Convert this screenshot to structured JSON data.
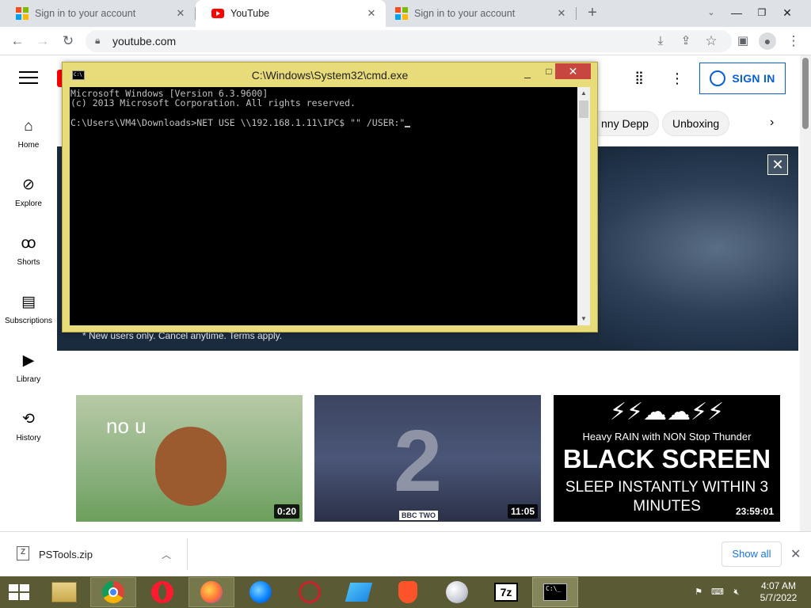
{
  "browser": {
    "tabs": [
      {
        "title": "Sign in to your account",
        "icon": "google-icon",
        "active": false
      },
      {
        "title": "YouTube",
        "icon": "youtube-icon",
        "active": true
      },
      {
        "title": "Sign in to your account",
        "icon": "google-icon",
        "active": false
      }
    ],
    "tab_close": "✕",
    "new_tab": "+",
    "url": "youtube.com"
  },
  "youtube": {
    "nav": [
      {
        "label": "Home",
        "icon": "home-icon"
      },
      {
        "label": "Explore",
        "icon": "compass-icon"
      },
      {
        "label": "Shorts",
        "icon": "shorts-icon"
      },
      {
        "label": "Subscriptions",
        "icon": "subscriptions-icon"
      },
      {
        "label": "Library",
        "icon": "library-icon"
      },
      {
        "label": "History",
        "icon": "history-icon"
      }
    ],
    "sign_in": "SIGN IN",
    "chips": [
      "nny Depp",
      "Unboxing"
    ],
    "banner_note": "* New users only. Cancel anytime. Terms apply.",
    "videos": [
      {
        "overlay": "no u",
        "duration": "0:20"
      },
      {
        "overlay": "BBC TWO",
        "duration": "11:05"
      },
      {
        "overlay_line1": "Heavy RAIN with NON Stop Thunder",
        "overlay_line2": "BLACK SCREEN",
        "overlay_line3": "SLEEP INSTANTLY WITHIN 3",
        "overlay_line4": "MINUTES",
        "duration": "23:59:01"
      }
    ]
  },
  "cmd": {
    "title": "C:\\Windows\\System32\\cmd.exe",
    "lines": [
      "Microsoft Windows [Version 6.3.9600]",
      "(c) 2013 Microsoft Corporation. All rights reserved.",
      "",
      "C:\\Users\\VM4\\Downloads>NET USE \\\\192.168.1.11\\IPC$ \"\" /USER:\""
    ]
  },
  "download": {
    "file": "PSTools.zip",
    "show_all": "Show all"
  },
  "taskbar": {
    "apps": [
      "file-explorer-icon",
      "chrome-icon",
      "opera-icon",
      "firefox-icon",
      "firefox-dev-icon",
      "opera-gx-icon",
      "app-icon",
      "brave-icon",
      "sphere-icon",
      "7zip-icon",
      "cmd-icon"
    ],
    "app_labels": {
      "7zip": "7z",
      "cmd": "C:\\_"
    },
    "time": "4:07 AM",
    "date": "5/7/2022"
  },
  "colors": {
    "youtube_red": "#ff0000",
    "link_blue": "#065fd4",
    "taskbar": "#5a5a34",
    "cmd_frame": "#e8dc7a"
  }
}
